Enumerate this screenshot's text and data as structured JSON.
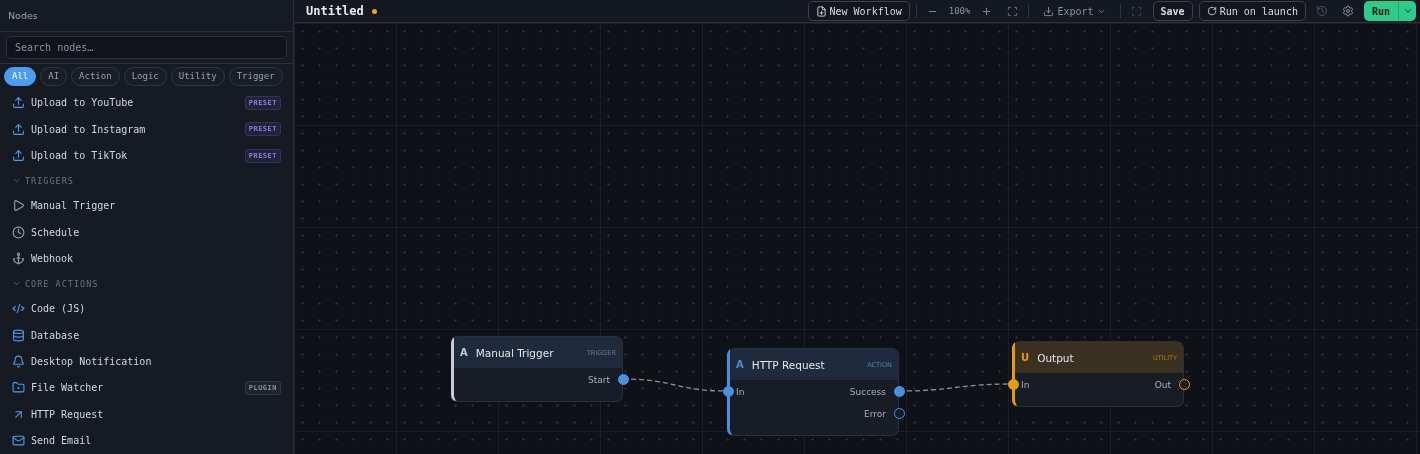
{
  "sidebar": {
    "title": "Nodes",
    "search": {
      "placeholder": "Search nodes…"
    },
    "filters": [
      {
        "label": "All",
        "selected": true
      },
      {
        "label": "AI",
        "selected": false
      },
      {
        "label": "Action",
        "selected": false
      },
      {
        "label": "Logic",
        "selected": false
      },
      {
        "label": "Utility",
        "selected": false
      },
      {
        "label": "Trigger",
        "selected": false
      }
    ],
    "sections": [
      {
        "items": [
          {
            "label": "Upload to YouTube",
            "badge": {
              "text": "PRESET",
              "kind": "preset"
            }
          },
          {
            "label": "Upload to Instagram",
            "badge": {
              "text": "PRESET",
              "kind": "preset"
            }
          },
          {
            "label": "Upload to TikTok",
            "badge": {
              "text": "PRESET",
              "kind": "preset"
            }
          }
        ]
      },
      {
        "title": "TRIGGERS",
        "expanded": true,
        "items": [
          {
            "label": "Manual Trigger"
          },
          {
            "label": "Schedule"
          },
          {
            "label": "Webhook"
          }
        ]
      },
      {
        "title": "CORE ACTIONS",
        "expanded": true,
        "items": [
          {
            "label": "Code (JS)"
          },
          {
            "label": "Database"
          },
          {
            "label": "Desktop Notification"
          },
          {
            "label": "File Watcher",
            "badge": {
              "text": "PLUGIN",
              "kind": "plugin"
            }
          },
          {
            "label": "HTTP Request"
          },
          {
            "label": "Send Email"
          }
        ]
      }
    ]
  },
  "toolbar": {
    "title": "Untitled",
    "unsaved": true,
    "new_workflow": "New Workflow",
    "zoom": "100%",
    "export": "Export",
    "save": "Save",
    "run_on_launch": "Run on launch",
    "run": "Run"
  },
  "nodes": [
    {
      "kind": "trigger",
      "letter": "A",
      "title": "Manual Trigger",
      "tag": "TRIGGER",
      "outputs": [
        {
          "label": "Start",
          "connected": true
        }
      ]
    },
    {
      "kind": "action",
      "letter": "A",
      "title": "HTTP Request",
      "tag": "ACTION",
      "inputs": [
        {
          "label": "In",
          "connected": true
        }
      ],
      "outputs": [
        {
          "label": "Success",
          "connected": true
        },
        {
          "label": "Error",
          "connected": false
        }
      ]
    },
    {
      "kind": "utility",
      "letter": "U",
      "title": "Output",
      "tag": "UTILITY",
      "inputs": [
        {
          "label": "In",
          "connected": true
        }
      ],
      "outputs": [
        {
          "label": "Out",
          "connected": false
        }
      ]
    }
  ]
}
